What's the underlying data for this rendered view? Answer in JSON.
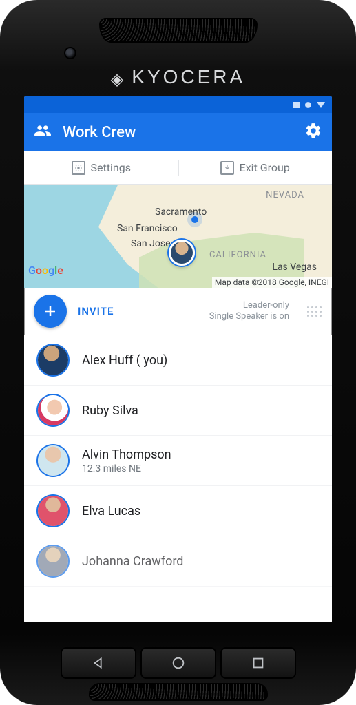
{
  "device_brand": "KYOCERA",
  "appbar": {
    "title": "Work Crew"
  },
  "toolbar": {
    "settings_label": "Settings",
    "exit_label": "Exit Group"
  },
  "map": {
    "state_label_1": "NEVADA",
    "state_label_2": "CALIFORNIA",
    "city_1": "Sacramento",
    "city_2": "San Francisco",
    "city_3": "San Jose",
    "city_4": "Las Vegas",
    "logo_g": "G",
    "logo_o1": "o",
    "logo_o2": "o",
    "logo_g2": "g",
    "logo_l": "l",
    "logo_e": "e",
    "credit": "Map data ©2018 Google, INEGI"
  },
  "invite": {
    "label": "INVITE",
    "status_line_1": "Leader-only",
    "status_line_2": "Single Speaker is on"
  },
  "members": [
    {
      "name": "Alex Huff ( you)",
      "sub": ""
    },
    {
      "name": "Ruby Silva",
      "sub": ""
    },
    {
      "name": "Alvin Thompson",
      "sub": "12.3 miles NE"
    },
    {
      "name": "Elva Lucas",
      "sub": ""
    },
    {
      "name": "Johanna Crawford",
      "sub": ""
    }
  ]
}
